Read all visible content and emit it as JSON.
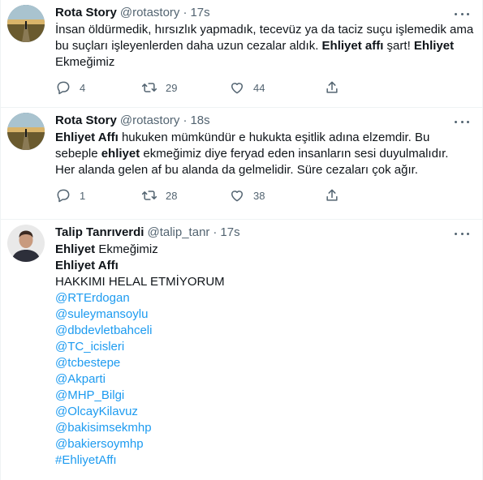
{
  "colors": {
    "text": "#0f1419",
    "secondary": "#536471",
    "link": "#1d9bf0",
    "border": "#eff3f4"
  },
  "tweets": [
    {
      "name": "Rota Story",
      "handle": "@rotastory",
      "separator": "·",
      "time": "17s",
      "lines": [
        [
          {
            "t": "İnsan öldürmedik, hırsızlık yapmadık, tecevüz ya da taciz suçu işlemedik ama",
            "s": "normal"
          }
        ],
        [
          {
            "t": "bu suçları işleyenlerden daha uzun cezalar aldık. ",
            "s": "normal"
          },
          {
            "t": "Ehliyet affı",
            "s": "bold"
          },
          {
            "t": " şart! ",
            "s": "normal"
          },
          {
            "t": "Ehliyet",
            "s": "bold"
          }
        ],
        [
          {
            "t": "Ekmeğimiz",
            "s": "normal"
          }
        ]
      ],
      "replies": "4",
      "retweets": "29",
      "likes": "44"
    },
    {
      "name": "Rota Story",
      "handle": "@rotastory",
      "separator": "·",
      "time": "18s",
      "lines": [
        [
          {
            "t": "Ehliyet Affı",
            "s": "bold"
          },
          {
            "t": " hukuken mümkündür e hukukta eşitlik adına elzemdir. Bu",
            "s": "normal"
          }
        ],
        [
          {
            "t": "sebeple ",
            "s": "normal"
          },
          {
            "t": "ehliyet",
            "s": "bold"
          },
          {
            "t": " ekmeğimiz diye feryad eden insanların sesi duyulmalıdır.",
            "s": "normal"
          }
        ],
        [
          {
            "t": "Her alanda gelen af bu alanda da gelmelidir. Süre cezaları çok ağır.",
            "s": "normal"
          }
        ]
      ],
      "replies": "1",
      "retweets": "28",
      "likes": "38"
    },
    {
      "name": "Talip Tanrıverdi",
      "handle": "@talip_tanr",
      "separator": "·",
      "time": "17s",
      "lines": [
        [
          {
            "t": "Ehliyet",
            "s": "bold"
          },
          {
            "t": " Ekmeğimiz",
            "s": "normal"
          }
        ],
        [
          {
            "t": "Ehliyet Affı",
            "s": "bold"
          }
        ],
        [
          {
            "t": "HAKKIMI HELAL ETMİYORUM",
            "s": "normal"
          }
        ],
        [
          {
            "t": "@RTErdogan",
            "s": "link"
          }
        ],
        [
          {
            "t": "@suleymansoylu",
            "s": "link"
          }
        ],
        [
          {
            "t": "@dbdevletbahceli",
            "s": "link"
          }
        ],
        [
          {
            "t": "@TC_icisleri",
            "s": "link"
          }
        ],
        [
          {
            "t": "@tcbestepe",
            "s": "link"
          }
        ],
        [
          {
            "t": "@Akparti",
            "s": "link"
          }
        ],
        [
          {
            "t": "@MHP_Bilgi",
            "s": "link"
          }
        ],
        [
          {
            "t": "@OlcayKilavuz",
            "s": "link"
          }
        ],
        [
          {
            "t": "@bakisimsekmhp",
            "s": "link"
          }
        ],
        [
          {
            "t": "@bakiersoymhp",
            "s": "link"
          }
        ],
        [
          {
            "t": "#EhliyetAffı",
            "s": "link"
          }
        ]
      ]
    }
  ]
}
